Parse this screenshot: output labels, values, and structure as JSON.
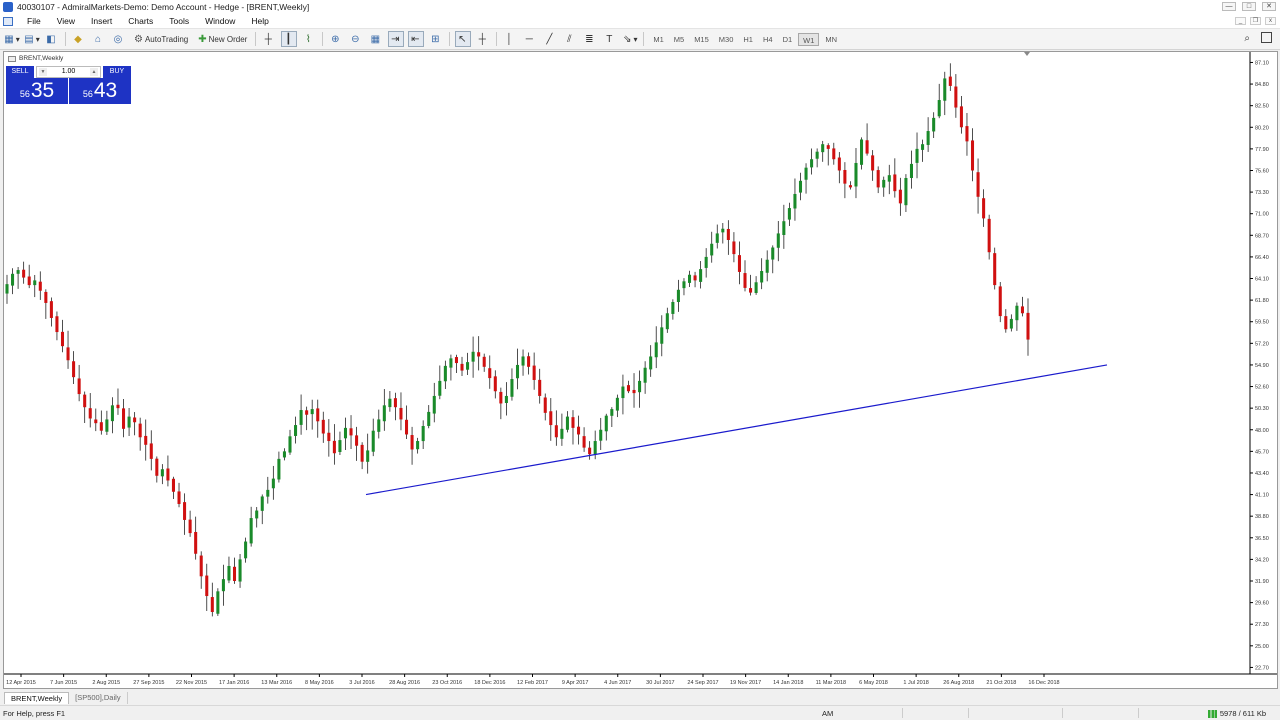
{
  "window": {
    "title": "40030107 - AdmiralMarkets-Demo: Demo Account - Hedge - [BRENT,Weekly]",
    "buttons": [
      "—",
      "□",
      "✕"
    ]
  },
  "menu": {
    "items": [
      "File",
      "View",
      "Insert",
      "Charts",
      "Tools",
      "Window",
      "Help"
    ]
  },
  "toolbar": {
    "autotrading_label": "AutoTrading",
    "new_order_label": "New Order",
    "timeframes": [
      "M1",
      "M5",
      "M15",
      "M30",
      "H1",
      "H4",
      "D1",
      "W1",
      "MN"
    ],
    "active_timeframe": "W1"
  },
  "chart": {
    "symbol_label": "BRENT,Weekly",
    "one_click": {
      "sell_label": "SELL",
      "buy_label": "BUY",
      "volume": "1.00",
      "sell_small": "56",
      "sell_big": "35",
      "buy_small": "56",
      "buy_big": "43"
    },
    "trendline_color": "#1a1acc",
    "bull_color": "#1a8a2a",
    "bear_color": "#d01010"
  },
  "chart_data": {
    "type": "candlestick",
    "y_tick_labels": [
      "87.10",
      "84.80",
      "82.50",
      "80.20",
      "77.90",
      "75.60",
      "73.30",
      "71.00",
      "68.70",
      "66.40",
      "64.10",
      "61.80",
      "59.50",
      "57.20",
      "54.90",
      "52.60",
      "50.30",
      "48.00",
      "45.70",
      "43.40",
      "41.10",
      "38.80",
      "36.50",
      "34.20",
      "31.90",
      "29.60",
      "27.30",
      "25.00",
      "22.70"
    ],
    "ylim": [
      22.0,
      88.0
    ],
    "x_tick_labels": [
      "12 Apr 2015",
      "7 Jun 2015",
      "2 Aug 2015",
      "27 Sep 2015",
      "22 Nov 2015",
      "17 Jan 2016",
      "13 Mar 2016",
      "8 May 2016",
      "3 Jul 2016",
      "28 Aug 2016",
      "23 Oct 2016",
      "18 Dec 2016",
      "12 Feb 2017",
      "9 Apr 2017",
      "4 Jun 2017",
      "30 Jul 2017",
      "24 Sep 2017",
      "19 Nov 2017",
      "14 Jan 2018",
      "11 Mar 2018",
      "6 May 2018",
      "1 Jul 2018",
      "26 Aug 2018",
      "21 Oct 2018",
      "16 Dec 2018"
    ],
    "closes": [
      63.5,
      64.6,
      65.0,
      64.2,
      63.4,
      63.9,
      62.8,
      61.5,
      59.9,
      58.4,
      56.9,
      55.4,
      53.6,
      51.8,
      50.4,
      49.2,
      48.7,
      47.9,
      49.1,
      50.6,
      50.3,
      48.1,
      49.4,
      48.8,
      47.2,
      46.4,
      44.9,
      43.1,
      43.8,
      42.6,
      41.4,
      40.1,
      38.4,
      37.0,
      34.8,
      32.4,
      30.3,
      28.6,
      30.8,
      32.1,
      33.5,
      31.9,
      34.2,
      36.1,
      38.6,
      39.4,
      40.9,
      41.6,
      42.8,
      44.9,
      45.7,
      47.3,
      48.5,
      50.1,
      49.6,
      50.2,
      48.9,
      47.6,
      46.8,
      45.5,
      46.9,
      48.2,
      47.4,
      46.3,
      44.6,
      45.8,
      47.9,
      49.1,
      50.6,
      51.3,
      50.4,
      49.1,
      47.5,
      45.9,
      46.8,
      48.4,
      49.9,
      51.6,
      53.2,
      54.8,
      55.6,
      55.1,
      54.3,
      55.2,
      56.3,
      55.8,
      54.7,
      53.5,
      52.1,
      50.8,
      51.6,
      53.4,
      54.9,
      55.8,
      54.7,
      53.3,
      51.6,
      49.8,
      48.5,
      47.2,
      48.1,
      49.4,
      48.2,
      47.5,
      46.1,
      45.4,
      46.8,
      48.0,
      49.5,
      50.2,
      51.4,
      52.6,
      52.1,
      51.9,
      53.2,
      54.6,
      55.8,
      57.3,
      58.9,
      60.4,
      61.6,
      62.9,
      63.8,
      64.5,
      63.9,
      65.1,
      66.4,
      67.8,
      68.9,
      69.4,
      68.2,
      66.7,
      64.8,
      63.1,
      62.6,
      63.7,
      64.9,
      66.1,
      67.4,
      68.9,
      70.2,
      71.6,
      73.1,
      74.5,
      75.9,
      76.8,
      77.6,
      78.4,
      77.9,
      76.8,
      75.6,
      74.2,
      73.8,
      76.4,
      78.9,
      77.4,
      75.6,
      73.8,
      74.6,
      75.1,
      73.4,
      72.1,
      74.8,
      76.3,
      77.9,
      78.4,
      79.8,
      81.2,
      83.1,
      85.4,
      84.6,
      82.3,
      80.2,
      78.7,
      75.6,
      72.8,
      70.5,
      66.9,
      63.4,
      60.1,
      58.7,
      59.8,
      61.2,
      60.4,
      57.6
    ],
    "trendline": {
      "x1": "Jul 2016",
      "y1": 41.1,
      "x2": "Jan 2019",
      "y2": 54.9
    }
  },
  "tabs": [
    {
      "label": "BRENT,Weekly",
      "active": true
    },
    {
      "label": "[SP500],Daily",
      "active": false
    }
  ],
  "status": {
    "help_text": "For Help, press F1",
    "mode": "AM",
    "connection": "5978 / 611 Kb"
  }
}
